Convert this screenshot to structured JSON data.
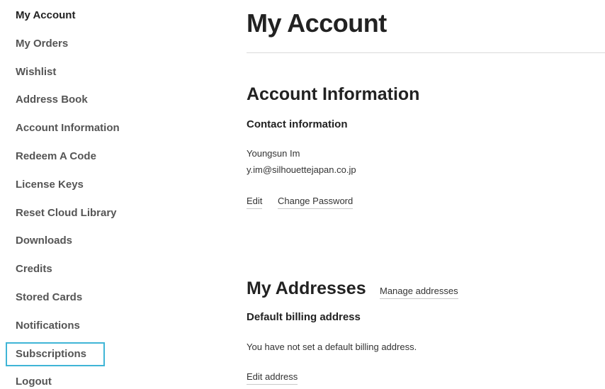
{
  "sidebar": {
    "items": [
      {
        "label": "My Account"
      },
      {
        "label": "My Orders"
      },
      {
        "label": "Wishlist"
      },
      {
        "label": "Address Book"
      },
      {
        "label": "Account Information"
      },
      {
        "label": "Redeem A Code"
      },
      {
        "label": "License Keys"
      },
      {
        "label": "Reset Cloud Library"
      },
      {
        "label": "Downloads"
      },
      {
        "label": "Credits"
      },
      {
        "label": "Stored Cards"
      },
      {
        "label": "Notifications"
      },
      {
        "label": "Subscriptions"
      },
      {
        "label": "Logout"
      }
    ],
    "current_item": "My Account",
    "focused_item": "Subscriptions",
    "focus_color": "#3fb5d6"
  },
  "main": {
    "title": "My Account",
    "account_info": {
      "title": "Account Information",
      "contact_title": "Contact information",
      "name": "Youngsun Im",
      "email": "y.im@silhouettejapan.co.jp",
      "edit_label": "Edit",
      "change_password_label": "Change Password"
    },
    "addresses": {
      "title": "My Addresses",
      "manage_label": "Manage addresses",
      "billing_title": "Default billing address",
      "billing_text": "You have not set a default billing address.",
      "edit_address_label": "Edit address"
    }
  }
}
